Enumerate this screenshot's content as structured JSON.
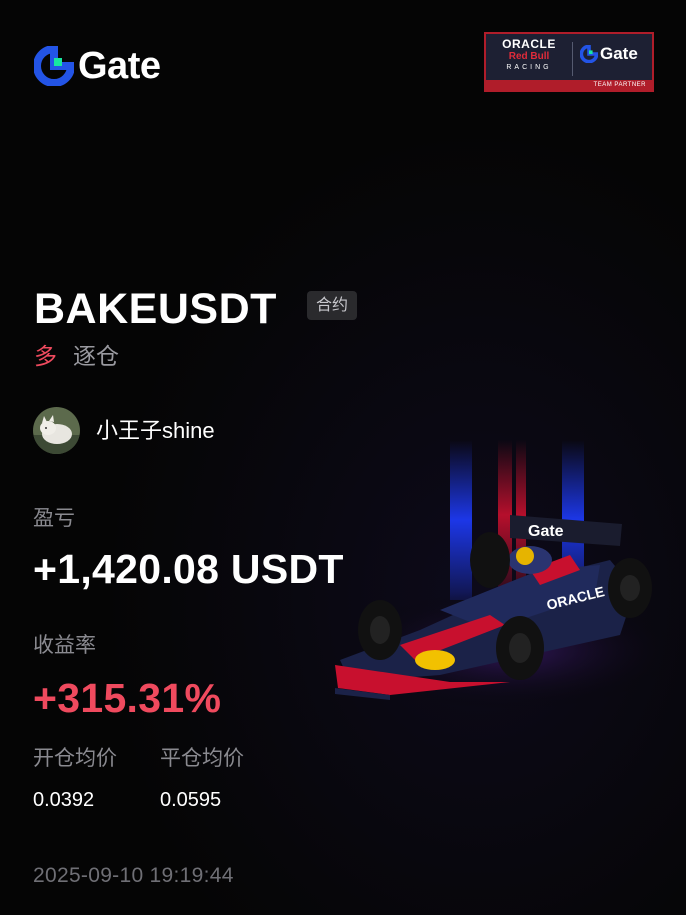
{
  "brand": {
    "name": "Gate",
    "logo_icon": "gate-logo-icon",
    "accent": "#2354e6",
    "accent_green": "#17e6a1"
  },
  "sponsor": {
    "oracle": "ORACLE",
    "red_bull": "Red Bull",
    "racing": "RACING",
    "gate": "Gate",
    "partner": "TEAM PARTNER",
    "color": "#b01d2a"
  },
  "position": {
    "pair": "BAKEUSDT",
    "type_tag": "合约",
    "direction": "多",
    "margin_mode": "逐仓"
  },
  "user": {
    "name": "小王子shine",
    "avatar_icon": "cat-avatar-icon"
  },
  "stats": {
    "pnl_label": "盈亏",
    "pnl_value": "+1,420.08 USDT",
    "roi_label": "收益率",
    "roi_value": "+315.31%",
    "open_price_label": "开仓均价",
    "close_price_label": "平仓均价",
    "open_price": "0.0392",
    "close_price": "0.0595"
  },
  "timestamp": "2025-09-10 19:19:44",
  "colors": {
    "profit": "#ef4a5e",
    "label": "#8a8a90",
    "background": "#050505"
  },
  "illustration": {
    "icon": "f1-race-car-icon",
    "livery_text": "Gate"
  }
}
